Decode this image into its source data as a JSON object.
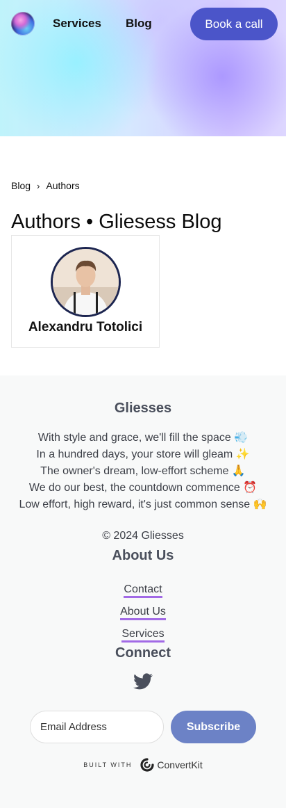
{
  "nav": {
    "services_label": "Services",
    "blog_label": "Blog",
    "cta_label": "Book a call"
  },
  "breadcrumb": {
    "items": [
      "Blog",
      "Authors"
    ],
    "separator": "›"
  },
  "page_title": "Authors • Gliesess Blog",
  "authors": [
    {
      "name": "Alexandru Totolici"
    }
  ],
  "footer": {
    "brand": "Gliesses",
    "poem": [
      "With style and grace, we'll fill the space 💨",
      "In a hundred days, your store will gleam ✨",
      "The owner's dream, low-effort scheme 🙏",
      "We do our best, the countdown commence ⏰",
      "Low effort, high reward, it's just common sense 🙌"
    ],
    "copyright": "© 2024 Gliesses",
    "about_heading": "About Us",
    "links": [
      "Contact",
      "About Us",
      "Services"
    ],
    "connect_heading": "Connect",
    "email_placeholder": "Email Address",
    "subscribe_label": "Subscribe",
    "built_with": "BUILT WITH",
    "convertkit": "ConvertKit"
  },
  "colors": {
    "cta": "#4b55c9",
    "subscribe": "#6c82c6",
    "link_underline": "#a26ae6",
    "footer_bg": "#f8f9f9"
  }
}
